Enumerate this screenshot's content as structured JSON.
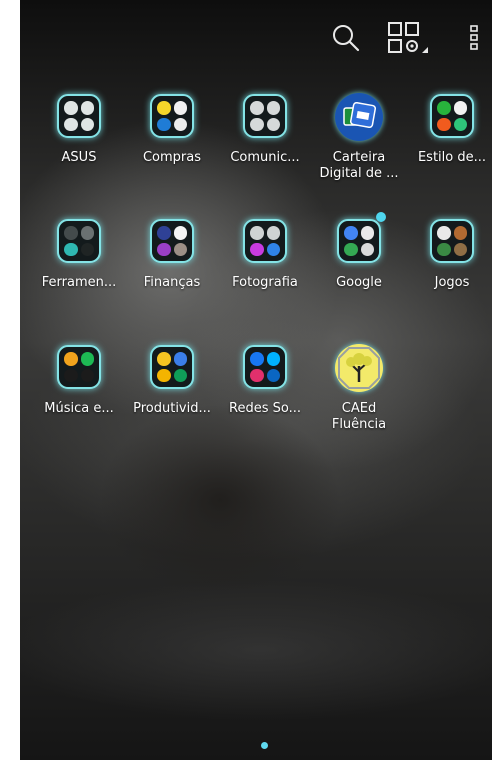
{
  "toolbar": {
    "icons": [
      "search-icon",
      "apps-settings-icon",
      "overflow-menu-icon"
    ]
  },
  "apps": [
    {
      "label": "ASUS",
      "type": "folder",
      "minis": [
        "#dfe5e4",
        "#dfe5e4",
        "#dfe5e4",
        "#dfe5e4"
      ]
    },
    {
      "label": "Compras",
      "type": "folder",
      "minis": [
        "#f5d52a",
        "#f1f1f1",
        "#1f7cd6",
        "#ececec"
      ]
    },
    {
      "label": "Comunic...",
      "type": "folder",
      "minis": [
        "#d6d9d9",
        "#d6d9d9",
        "#d6d9d9",
        "#d6d9d9"
      ]
    },
    {
      "label": "Carteira\nDigital de ...",
      "type": "app",
      "color": "#1a55b3"
    },
    {
      "label": "Estilo de...",
      "type": "folder",
      "minis": [
        "#28b33c",
        "#f2f2f2",
        "#f15b1e",
        "#2ec47a"
      ]
    },
    {
      "label": "Ferramen...",
      "type": "folder",
      "minis": [
        "#444b4c",
        "#6a7172",
        "#2fb7b1",
        "#1f2424"
      ]
    },
    {
      "label": "Finanças",
      "type": "folder",
      "minis": [
        "#2f4196",
        "#f4f4f4",
        "#9a3fc6",
        "#9c8f86"
      ]
    },
    {
      "label": "Fotografia",
      "type": "folder",
      "minis": [
        "#cfd3d3",
        "#cfd3d3",
        "#c83be0",
        "#2f83e8"
      ]
    },
    {
      "label": "Google",
      "type": "folder",
      "badge": true,
      "minis": [
        "#4285f4",
        "#e9e9e9",
        "#34a853",
        "#d9dbdb"
      ]
    },
    {
      "label": "Jogos",
      "type": "folder",
      "minis": [
        "#e9e9e9",
        "#b26a31",
        "#3a8a44",
        "#8f6e45"
      ]
    },
    {
      "label": "Música e...",
      "type": "folder",
      "minis": [
        "#f0a31d",
        "#1db954",
        "#1b1b1b",
        "#1b1b1b"
      ]
    },
    {
      "label": "Produtivid...",
      "type": "folder",
      "minis": [
        "#f6c422",
        "#3b7ee9",
        "#f4b400",
        "#0f9d58"
      ]
    },
    {
      "label": "Redes So...",
      "type": "folder",
      "minis": [
        "#1877f2",
        "#00b2ff",
        "#e1306c",
        "#0a66c2"
      ]
    },
    {
      "label": "CAEd\nFluência",
      "type": "app",
      "color": "#f3ea6a"
    }
  ],
  "pager": {
    "pages": 1,
    "current": 1
  },
  "colors": {
    "accent": "#84e3e6",
    "dot": "#5fd9ef"
  }
}
